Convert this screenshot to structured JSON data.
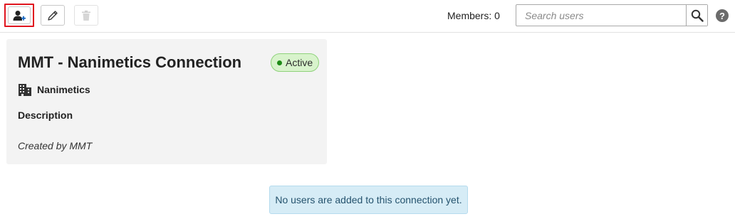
{
  "toolbar": {
    "add_user_icon": "add-user-icon",
    "edit_icon": "pencil-icon",
    "delete_icon": "trash-icon",
    "members_label": "Members: 0",
    "search_placeholder": "Search users",
    "search_icon": "search-icon",
    "help_label": "?"
  },
  "connection": {
    "title": "MMT - Nanimetics Connection",
    "status": "Active",
    "status_color": "#1e8b17",
    "organization": "Nanimetics",
    "description_label": "Description",
    "created_by": "Created by MMT"
  },
  "empty_state": {
    "message": "No users are added to this connection yet."
  },
  "colors": {
    "highlight": "#e0141e",
    "card_bg": "#f3f3f3",
    "info_bg": "#d6ecf6",
    "badge_bg": "#d8f3cc"
  }
}
